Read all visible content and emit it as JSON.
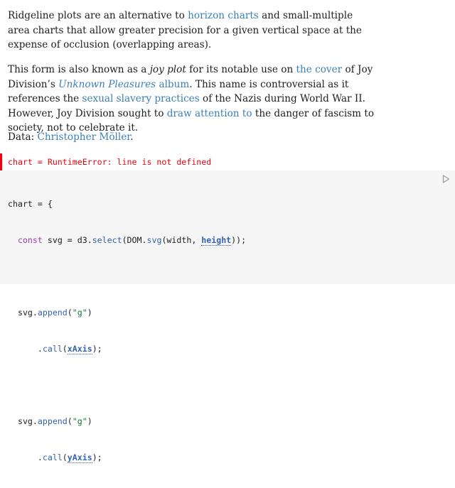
{
  "paragraph1": {
    "t1": "Ridgeline plots are an alternative to ",
    "link_horizon": "horizon charts",
    "t2": " and small-multiple area charts that allow greater precision for a given vertical space at the expense of occlusion (overlapping areas)."
  },
  "paragraph2": {
    "t1": "This form is also known as a ",
    "em_joy": "joy plot",
    "t2": " for its notable use on ",
    "link_cover": "the cover",
    "t3": " of Joy Division’s ",
    "link_album_title": "Unknown Pleasures",
    "link_album_word": " album",
    "t4": ". This name is controversial as it references the ",
    "link_slavery": "sexual slavery practices",
    "t5": " of the Nazis during World War II. However, Joy Division sought to ",
    "link_attention": "draw attention to",
    "t6": " the danger of fascism to society, not to celebrate it."
  },
  "paragraph3": {
    "t1": "Data: ",
    "link_author": "Christopher Möller",
    "t2": "."
  },
  "error": {
    "text": "chart = RuntimeError: line is not defined"
  },
  "code": {
    "l1_a": "chart = {",
    "l2_a": "  ",
    "l2_kw": "const",
    "l2_b": " svg = d3.",
    "l2_fn": "select",
    "l2_c": "(DOM.",
    "l2_fn2": "svg",
    "l2_d": "(width, ",
    "l2_ref": "height",
    "l2_e": "));",
    "l4_a": "  svg.",
    "l4_fn": "append",
    "l4_b": "(",
    "l4_str": "\"g\"",
    "l4_c": ")",
    "l5_a": "      .",
    "l5_fn": "call",
    "l5_b": "(",
    "l5_ref": "xAxis",
    "l5_c": ");",
    "l7_a": "  svg.",
    "l7_fn": "append",
    "l7_b": "(",
    "l7_str": "\"g\"",
    "l7_c": ")",
    "l8_a": "      .",
    "l8_fn": "call",
    "l8_b": "(",
    "l8_ref": "yAxis",
    "l8_c": ");"
  },
  "colors": {
    "link": "#3b7fb6",
    "error": "#e7040f",
    "code_background": "#f5f5f5"
  },
  "icons": {
    "run": "play-icon"
  }
}
